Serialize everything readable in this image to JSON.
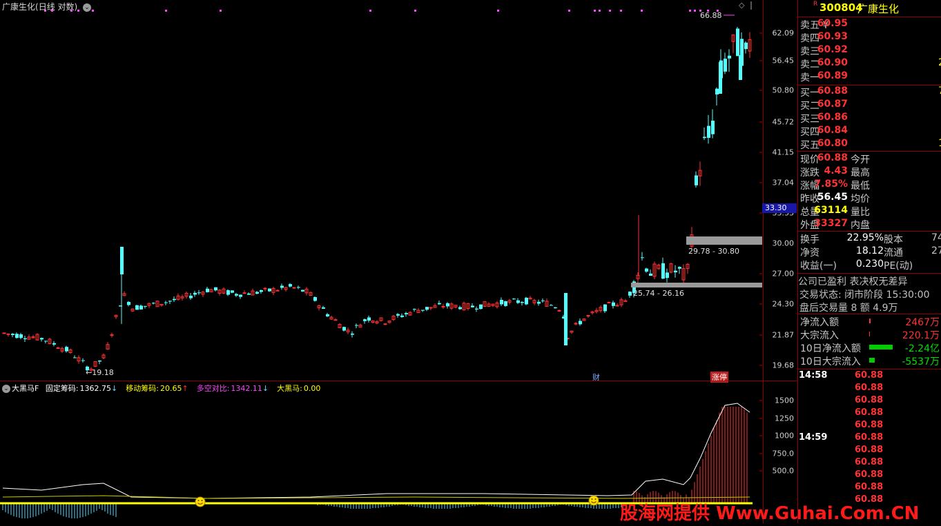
{
  "main_title": {
    "name": "广康生化",
    "mode": "(日线 对数)"
  },
  "main_axis": {
    "ticks": [
      "62.09",
      "56.45",
      "50.80",
      "45.72",
      "41.15",
      "37.04",
      "33.33",
      "30.00",
      "27.00",
      "24.30",
      "21.87",
      "19.68"
    ],
    "current": "33.30"
  },
  "annotations": {
    "high": "66.88",
    "low": "19.18",
    "zone_upper": "29.78 - 30.80",
    "zone_lower": "25.74 - 26.16",
    "badge_fin": "财",
    "badge_limit": "涨停"
  },
  "indicator": {
    "name": "大黑马F",
    "items": [
      {
        "label": "固定筹码:",
        "value": "1362.75",
        "arrow": "↓",
        "color": "#ffffff"
      },
      {
        "label": "移动筹码:",
        "value": "20.65",
        "arrow": "↑",
        "color": "#ffff00"
      },
      {
        "label": "多空对比:",
        "value": "1342.11",
        "arrow": "↓",
        "color": "#ff44ff"
      },
      {
        "label": "大黑马:",
        "value": "0.00",
        "arrow": "",
        "color": "#ffff00"
      }
    ],
    "axis_ticks": [
      "1500",
      "1250",
      "1000",
      "750.0",
      "500.0"
    ]
  },
  "watermark": "股海网提供 Www.Guhai.Com.CN",
  "quote": {
    "code": "300804",
    "name": "广康生化",
    "flag": "R",
    "asks": [
      {
        "label": "卖五 ¥",
        "price": "60.95",
        "vol": ""
      },
      {
        "label": "卖四",
        "price": "60.93",
        "vol": ""
      },
      {
        "label": "卖三",
        "price": "60.92",
        "vol": ""
      },
      {
        "label": "卖二",
        "price": "60.90",
        "vol": "2"
      },
      {
        "label": "卖一",
        "price": "60.89",
        "vol": ""
      }
    ],
    "bids": [
      {
        "label": "买一",
        "price": "60.88",
        "vol": "7"
      },
      {
        "label": "买二",
        "price": "60.87",
        "vol": ""
      },
      {
        "label": "买三",
        "price": "60.86",
        "vol": ""
      },
      {
        "label": "买四",
        "price": "60.84",
        "vol": ""
      },
      {
        "label": "买五",
        "price": "60.80",
        "vol": "1"
      }
    ],
    "stats": [
      {
        "label": "现价",
        "value": "60.88",
        "color": "red",
        "label2": "今开"
      },
      {
        "label": "涨跌",
        "value": "4.43",
        "color": "red",
        "label2": "最高"
      },
      {
        "label": "涨幅",
        "value": "7.85%",
        "color": "red",
        "label2": "最低"
      },
      {
        "label": "昨收",
        "value": "56.45",
        "color": "white",
        "label2": "均价"
      },
      {
        "label": "总量",
        "value": "63114",
        "color": "yellow",
        "label2": "量比"
      },
      {
        "label": "外盘",
        "value": "33327",
        "color": "red",
        "label2": "内盘"
      }
    ],
    "stats2": [
      {
        "label": "换手",
        "value": "22.95%",
        "label2": "股本",
        "value2": "74"
      },
      {
        "label": "净资",
        "value": "18.12",
        "label2": "流通",
        "value2": "27"
      },
      {
        "label": "收益(一)",
        "value": "0.230",
        "label2": "PE(动)",
        "value2": ""
      }
    ],
    "notice": "公司已盈利 表决权无差异",
    "trade_status": "交易状态: 闭市阶段 15:30:00",
    "after_hours": "盘后交易量 8 额 4.9万",
    "flows": [
      {
        "label": "净流入额",
        "value": "2467万",
        "color": "red",
        "bar": 2,
        "barcolor": "#ff3333"
      },
      {
        "label": "大宗流入",
        "value": "220.1万",
        "color": "red",
        "bar": 1,
        "barcolor": "#ff3333"
      },
      {
        "label": "10日净流入额",
        "value": "-2.24亿",
        "color": "green",
        "bar": 34,
        "barcolor": "#00cc00"
      },
      {
        "label": "10日大宗流入",
        "value": "-5537万",
        "color": "green",
        "bar": 8,
        "barcolor": "#00cc00"
      }
    ],
    "ticks": [
      {
        "time": "14:58",
        "price": "60.88"
      },
      {
        "time": "",
        "price": "60.88"
      },
      {
        "time": "",
        "price": "60.88"
      },
      {
        "time": "",
        "price": "60.88"
      },
      {
        "time": "",
        "price": "60.88"
      },
      {
        "time": "14:59",
        "price": "60.88"
      },
      {
        "time": "",
        "price": "60.88"
      },
      {
        "time": "",
        "price": "60.88"
      },
      {
        "time": "",
        "price": "60.88"
      },
      {
        "time": "",
        "price": "60.88"
      },
      {
        "time": "",
        "price": "60.88"
      }
    ]
  },
  "colors": {
    "up": "#ff3333",
    "down": "#54ffff",
    "border": "#8b0000",
    "grid": "#b00000"
  }
}
